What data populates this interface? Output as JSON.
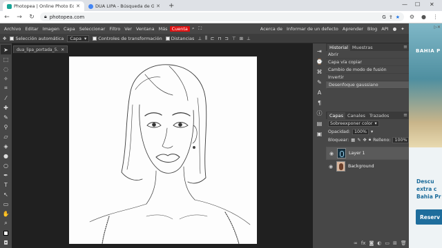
{
  "browser": {
    "tabs": [
      {
        "title": "Photopea | Online Photo Editor",
        "favicon_color": "#18a497"
      },
      {
        "title": "DUA LIPA - Búsqueda de Google",
        "favicon_color": "#4285f4"
      }
    ],
    "url": "photopea.com"
  },
  "menu": {
    "items": [
      "Archivo",
      "Editar",
      "Imagen",
      "Capa",
      "Seleccionar",
      "Filtro",
      "Ver",
      "Ventana",
      "Más"
    ],
    "highlight": "Cuenta",
    "right_links": [
      "Acerca de",
      "Informar de un defecto",
      "Aprender",
      "Blog",
      "API"
    ]
  },
  "options": {
    "auto_select_label": "Selección automática",
    "auto_select_value": "Capa",
    "transform_label": "Controles de transformación",
    "distances_label": "Distancias"
  },
  "document": {
    "tab_name": "dua_lipa_portada_5."
  },
  "history": {
    "tabs": [
      "Historial",
      "Muestras"
    ],
    "items": [
      "Abrir",
      "Capa vía copiar",
      "Cambio de modo de fusión",
      "Invertir",
      "Desenfoque gaussiano"
    ]
  },
  "layers": {
    "tabs": [
      "Capas",
      "Canales",
      "Trazados"
    ],
    "blend_mode": "Sobreexponer color",
    "opacity_label": "Opacidad:",
    "opacity_value": "100%",
    "lock_label": "Bloquear:",
    "fill_label": "Relleno:",
    "fill_value": "100%",
    "items": [
      {
        "name": "Layer 1",
        "selected": true
      },
      {
        "name": "Background",
        "selected": false
      }
    ]
  },
  "ad": {
    "brand": "BAHIA P",
    "line1": "Descu",
    "line2": "extra c",
    "line3": "Bahia Pr",
    "button": "Reserv"
  }
}
